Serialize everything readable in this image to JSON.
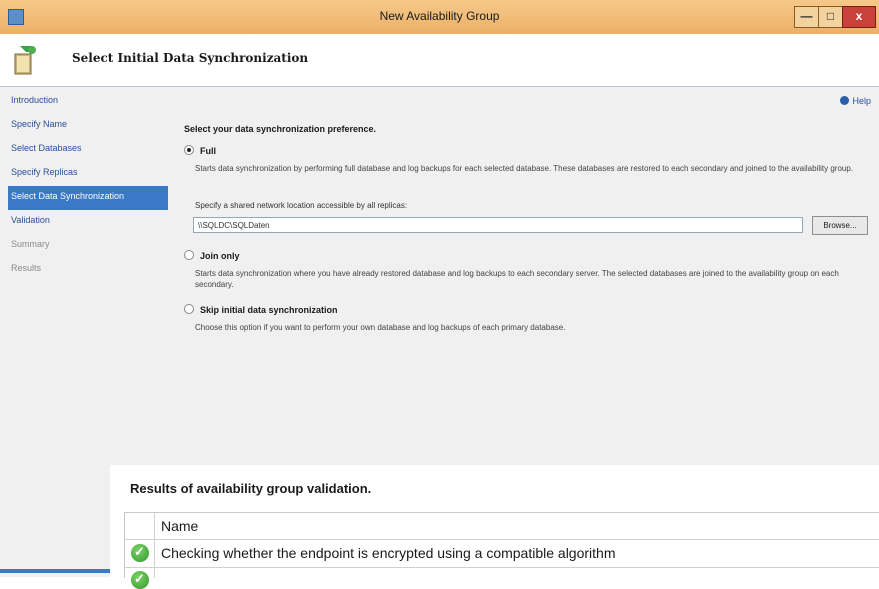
{
  "window": {
    "title": "New Availability Group"
  },
  "titlebar": {
    "min_glyph": "—",
    "max_glyph": "□",
    "close_glyph": "x"
  },
  "header": {
    "title": "Select Initial Data Synchronization",
    "icon": "wizard-page-icon"
  },
  "nav": {
    "items": [
      {
        "label": "Introduction",
        "state": "link"
      },
      {
        "label": "Specify Name",
        "state": "link"
      },
      {
        "label": "Select Databases",
        "state": "link"
      },
      {
        "label": "Specify Replicas",
        "state": "link"
      },
      {
        "label": "Select Data Synchronization",
        "state": "active"
      },
      {
        "label": "Validation",
        "state": "link"
      },
      {
        "label": "Summary",
        "state": "disabled"
      },
      {
        "label": "Results",
        "state": "disabled"
      }
    ]
  },
  "help": {
    "label": "Help"
  },
  "sync": {
    "preference_label": "Select your data synchronization preference.",
    "options": [
      {
        "label": "Full",
        "selected": true,
        "description": "Starts data synchronization by performing full database and log backups for each selected database. These databases are restored to each secondary and joined to the availability group."
      },
      {
        "label": "Join only",
        "selected": false,
        "description": "Starts data synchronization where you have already restored database and log backups to each secondary server. The selected databases are joined to the availability group on each secondary."
      },
      {
        "label": "Skip initial data synchronization",
        "selected": false,
        "description": "Choose this option if you want to perform your own database and log backups of each primary database."
      }
    ],
    "share_label": "Specify a shared network location accessible by all replicas:",
    "share_value": "\\\\SQLDC\\SQLDaten",
    "browse_label": "Browse..."
  },
  "results": {
    "title": "Results of availability group validation.",
    "column_header": "Name",
    "rows": [
      {
        "status": "success",
        "name": "Checking whether the endpoint is encrypted using a compatible algorithm"
      },
      {
        "status": "success",
        "name": ""
      }
    ]
  },
  "colors": {
    "accent": "#3a78c8",
    "titlebar": "#ecb066",
    "success": "#2f9a2a"
  }
}
